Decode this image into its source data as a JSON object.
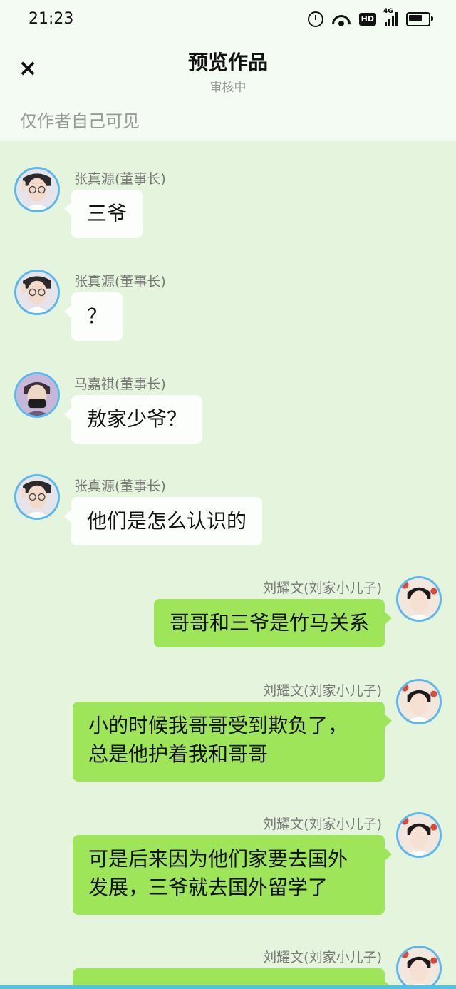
{
  "status_bar": {
    "time": "21:23",
    "hd_label": "HD",
    "network_label": "4G"
  },
  "header": {
    "title": "预览作品",
    "subtitle": "审核中",
    "close_icon": "×"
  },
  "visibility_note": "仅作者自己可见",
  "messages": [
    {
      "side": "left",
      "name": "张真源(董事长)",
      "text": "三爷",
      "avatar": "avatar-zhang"
    },
    {
      "side": "left",
      "name": "张真源(董事长)",
      "text": "？",
      "avatar": "avatar-zhang"
    },
    {
      "side": "left",
      "name": "马嘉祺(董事长)",
      "text": "敖家少爷？",
      "avatar": "avatar-ma"
    },
    {
      "side": "left",
      "name": "张真源(董事长)",
      "text": "他们是怎么认识的",
      "avatar": "avatar-zhang"
    },
    {
      "side": "right",
      "name": "刘耀文(刘家小儿子)",
      "text": "哥哥和三爷是竹马关系",
      "avatar": "avatar-liu"
    },
    {
      "side": "right",
      "name": "刘耀文(刘家小儿子)",
      "text": "小的时候我哥哥受到欺负了，\n总是他护着我和哥哥",
      "avatar": "avatar-liu"
    },
    {
      "side": "right",
      "name": "刘耀文(刘家小儿子)",
      "text": "可是后来因为他们家要去国外\n发展，三爷就去国外留学了",
      "avatar": "avatar-liu"
    },
    {
      "side": "right",
      "name": "刘耀文(刘家小儿子)",
      "text": "",
      "avatar": "avatar-liu"
    }
  ]
}
